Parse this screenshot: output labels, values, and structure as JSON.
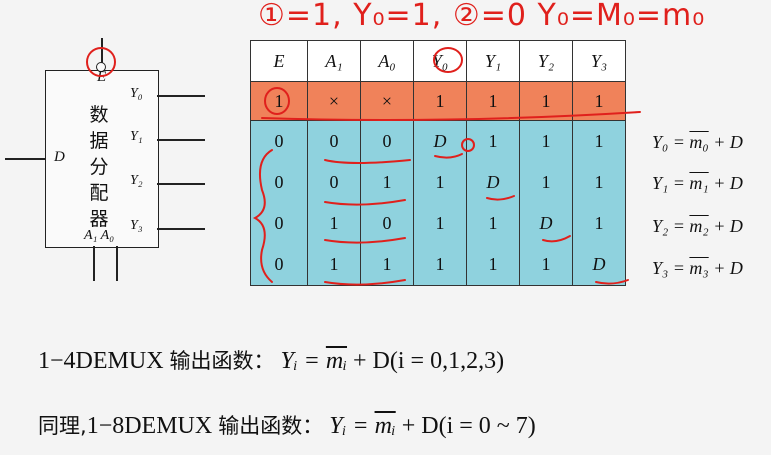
{
  "annotation_top": "①=1, Y₀=1, ②=0 Y₀=M₀=m₀",
  "block": {
    "label_chars": [
      "数",
      "据",
      "分",
      "配",
      "器"
    ],
    "enable_pin": "E",
    "data_pin": "D",
    "address_pins": "A₁ A₀",
    "outputs": [
      "Y₀",
      "Y₁",
      "Y₂",
      "Y₃"
    ]
  },
  "table": {
    "headers": [
      "E",
      "A₁",
      "A₀",
      "Y₀",
      "Y₁",
      "Y₂",
      "Y₃"
    ],
    "rows": [
      [
        "1",
        "×",
        "×",
        "1",
        "1",
        "1",
        "1"
      ],
      [
        "0",
        "0",
        "0",
        "D",
        "1",
        "1",
        "1"
      ],
      [
        "0",
        "0",
        "1",
        "1",
        "D",
        "1",
        "1"
      ],
      [
        "0",
        "1",
        "0",
        "1",
        "1",
        "D",
        "1"
      ],
      [
        "0",
        "1",
        "1",
        "1",
        "1",
        "1",
        "D"
      ]
    ]
  },
  "equations": [
    {
      "lhs": "Y₀ = ",
      "m": "m₀",
      "rhs": " + D"
    },
    {
      "lhs": "Y₁ = ",
      "m": "m₁",
      "rhs": " + D"
    },
    {
      "lhs": "Y₂ = ",
      "m": "m₂",
      "rhs": " + D"
    },
    {
      "lhs": "Y₃ = ",
      "m": "m₃",
      "rhs": " + D"
    }
  ],
  "formula1": {
    "prefix": "1−4DEMUX ",
    "cn": "输出函数：",
    "lhs": " Yᵢ = ",
    "m": "mᵢ",
    "rhs": " + D(i = 0,1,2,3)"
  },
  "formula2": {
    "cn_start": "同理,",
    "prefix": "1−8DEMUX ",
    "cn": "输出函数：",
    "lhs": " Yᵢ = ",
    "m": "mᵢ",
    "rhs": " + D(i = 0 ~ 7)"
  },
  "colors": {
    "highlight_row": "#f0825a",
    "data_rows": "#8fd2de",
    "ink": "#e0201c"
  }
}
